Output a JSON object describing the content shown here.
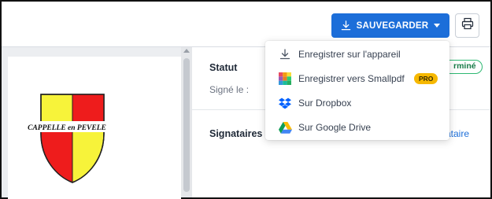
{
  "toolbar": {
    "save_label": "SAUVEGARDER",
    "save_icon": "download-icon",
    "print_icon": "printer-icon",
    "accent_color": "#1c6ed9"
  },
  "document": {
    "crest_text": "CAPPELLE en PEVELE",
    "crest_colors": {
      "red": "#ee1c1c",
      "yellow": "#f7f33a"
    }
  },
  "panel": {
    "statut_label": "Statut",
    "status_badge": "rminé",
    "signed_label": "Signé le :",
    "signataires_label": "Signataires",
    "add_link": "ataire"
  },
  "dropdown": {
    "items": [
      {
        "label": "Enregistrer sur l'appareil",
        "icon": "download-icon"
      },
      {
        "label": "Enregistrer vers Smallpdf",
        "icon": "smallpdf-icon",
        "badge": "PRO"
      },
      {
        "label": "Sur Dropbox",
        "icon": "dropbox-icon"
      },
      {
        "label": "Sur Google Drive",
        "icon": "google-drive-icon"
      }
    ]
  }
}
